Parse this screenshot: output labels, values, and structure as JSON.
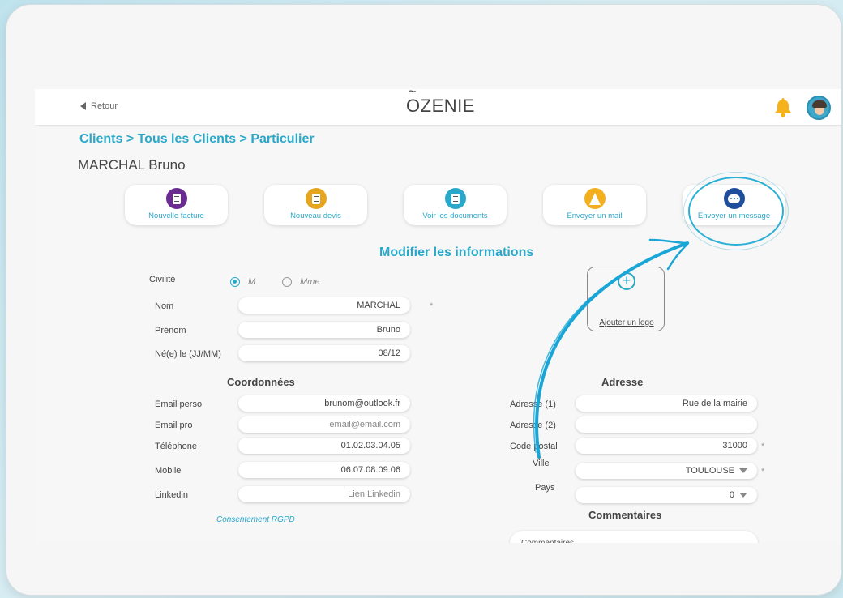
{
  "topbar": {
    "back_label": "Retour",
    "logo_text": "ZENIE",
    "logo_letter": "O"
  },
  "breadcrumb": "Clients > Tous les Clients > Particulier",
  "client_name": "MARCHAL Bruno",
  "actions": [
    {
      "label": "Nouvelle facture",
      "icon": "invoice-icon",
      "color": "#6a2c91"
    },
    {
      "label": "Nouveau devis",
      "icon": "quote-icon",
      "color": "#e6a51e"
    },
    {
      "label": "Voir les documents",
      "icon": "documents-icon",
      "color": "#2aa8c9"
    },
    {
      "label": "Envoyer un mail",
      "icon": "mail-sail-icon",
      "color": "#f2b01e"
    },
    {
      "label": "Envoyer un message",
      "icon": "message-icon",
      "color": "#1f4f9c"
    }
  ],
  "form": {
    "title": "Modifier les informations",
    "civilite_label": "Civilité",
    "civilite_options": [
      "M",
      "Mme"
    ],
    "nom_label": "Nom",
    "nom_value": "MARCHAL",
    "prenom_label": "Prénom",
    "prenom_value": "Bruno",
    "naissance_label": "Né(e) le (JJ/MM)",
    "naissance_value": "08/12",
    "required_mark": "*",
    "add_logo": "Ajouter un logo",
    "add_logo_glyph": "+"
  },
  "coordonnees": {
    "title": "Coordonnées",
    "email_perso_label": "Email perso",
    "email_perso_value": "brunom@outlook.fr",
    "email_pro_label": "Email pro",
    "email_pro_placeholder": "email@email.com",
    "telephone_label": "Téléphone",
    "telephone_value": "01.02.03.04.05",
    "mobile_label": "Mobile",
    "mobile_value": "06.07.08.09.06",
    "linkedin_label": "Linkedin",
    "linkedin_placeholder": "Lien Linkedin",
    "rgpd_link": "Consentement RGPD"
  },
  "adresse": {
    "title": "Adresse",
    "adresse1_label": "Adresse (1)",
    "adresse1_value": "Rue de la mairie",
    "adresse2_label": "Adresse (2)",
    "adresse2_value": "",
    "cp_label": "Code postal",
    "cp_value": "31000",
    "ville_label": "Ville",
    "ville_value": "TOULOUSE",
    "pays_label": "Pays",
    "pays_value": "0"
  },
  "commentaires": {
    "title": "Commentaires",
    "placeholder": "Commentaires"
  },
  "colors": {
    "accent": "#2aa8c9",
    "bell": "#f5b21a"
  }
}
